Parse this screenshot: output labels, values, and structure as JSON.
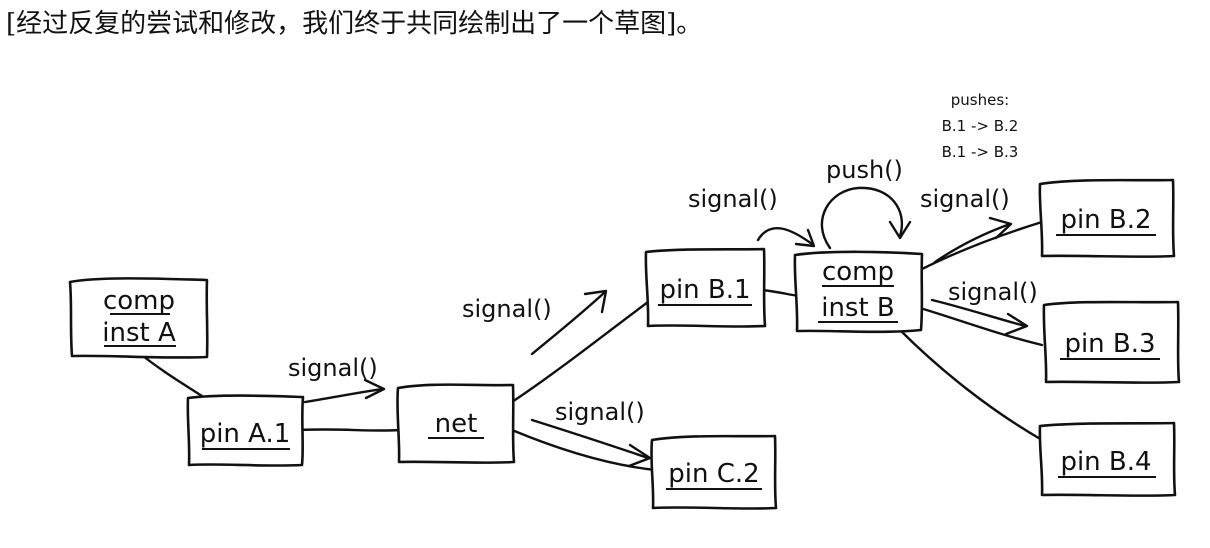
{
  "caption": "[经过反复的尝试和修改，我们终于共同绘制出了一个草图]。",
  "nodes": {
    "comp_inst_a": [
      "comp",
      "inst A"
    ],
    "pin_a1": "pin A.1",
    "net": "net",
    "pin_c2": "pin C.2",
    "pin_b1": "pin B.1",
    "comp_inst_b": [
      "comp",
      "inst B"
    ],
    "pin_b2": "pin B.2",
    "pin_b3": "pin B.3",
    "pin_b4": "pin B.4"
  },
  "edges": {
    "a1_to_net": "signal()",
    "net_to_b1": "signal()",
    "net_to_c2": "signal()",
    "b1_to_compb": "signal()",
    "compb_self": "push()",
    "compb_to_b2": "signal()",
    "compb_to_b3": "signal()"
  },
  "note": {
    "title": "pushes:",
    "lines": [
      "B.1 -> B.2",
      "B.1 -> B.3"
    ]
  }
}
